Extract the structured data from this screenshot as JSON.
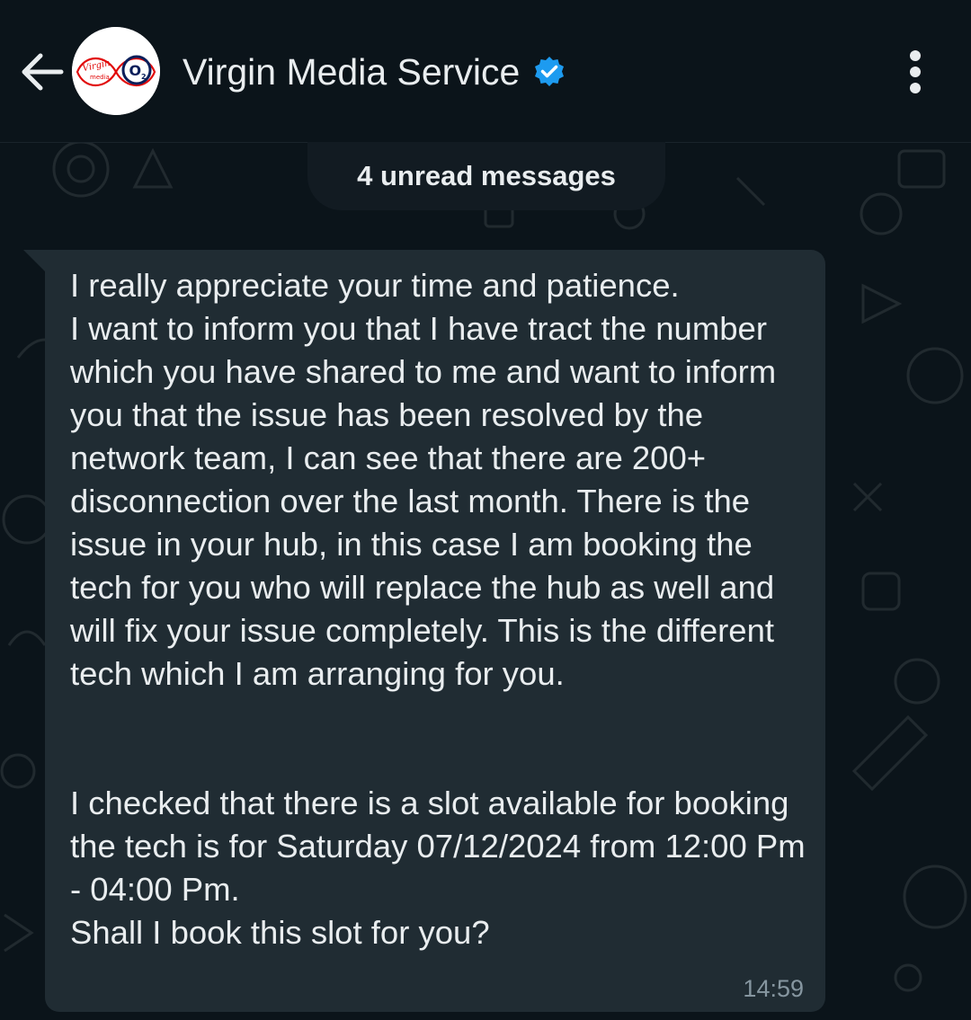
{
  "header": {
    "back_icon": "arrow-left-icon",
    "title": "Virgin Media Service",
    "verified_icon": "verified-badge-icon",
    "menu_icon": "more-vertical-icon",
    "avatar": {
      "brand_text": "Virgin media",
      "o2_text": "O2"
    }
  },
  "chat": {
    "unread_label": "4 unread messages",
    "messages": [
      {
        "direction": "incoming",
        "text": "I really appreciate your time and patience.\nI want to inform you that I have tract the number which you have shared to me and want to inform you that the issue has been resolved by the network team, I can see that there are 200+ disconnection over the last month. There is the issue in your hub, in this case I am booking the tech for you who will replace the hub as well and will fix your issue completely. This is the different tech which I am arranging for you.\n\n\nI checked that there is a slot available for booking the tech is for Saturday 07/12/2024 from 12:00 Pm - 04:00 Pm.\nShall I book this slot for you?",
        "time": "14:59"
      }
    ]
  },
  "colors": {
    "background": "#0b141a",
    "bubble_incoming": "#202c33",
    "text_primary": "#e9edef",
    "text_secondary": "#8696a0",
    "verified_blue": "#1d9bf0",
    "virgin_red": "#e10a0a",
    "o2_navy": "#0a1e5a"
  }
}
